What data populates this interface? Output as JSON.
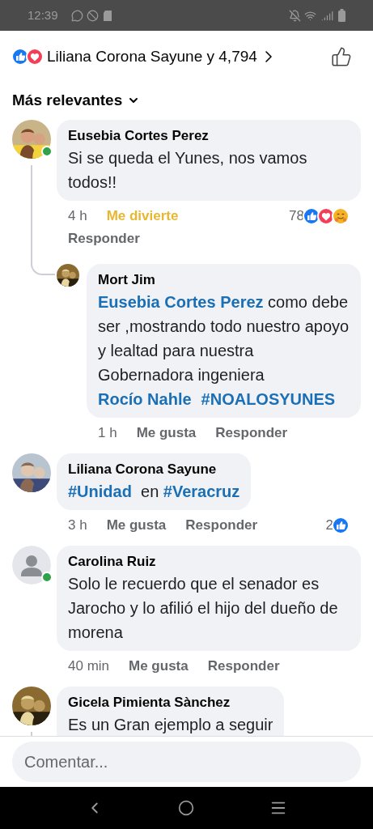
{
  "status_bar": {
    "time": "12:39"
  },
  "reactions_summary": {
    "reactions": [
      {
        "kind": "like"
      },
      {
        "kind": "love"
      }
    ],
    "text": "Liliana Corona Sayune y 4,794"
  },
  "sort": {
    "label": "Más relevantes"
  },
  "comments": [
    {
      "author": "Eusebia Cortes Perez",
      "avatar": {
        "kind": "picture"
      },
      "online": true,
      "thread_line": true,
      "segments": [
        {
          "kind": "plain",
          "text": "Si se queda el Yunes, nos vamos todos!!"
        }
      ],
      "time": "4 h",
      "actions": [
        {
          "label": "Me divierte",
          "reacted": true
        },
        {
          "label": "Responder",
          "reacted": false
        }
      ],
      "reaction_count": "78",
      "reactions": [
        {
          "kind": "like"
        },
        {
          "kind": "love"
        },
        {
          "kind": "haha"
        }
      ],
      "replies": [
        {
          "author": "Mort Jim",
          "avatar": {
            "kind": "picture"
          },
          "online": false,
          "thread_line": false,
          "segments": [
            {
              "kind": "mention",
              "text": "Eusebia Cortes Perez"
            },
            {
              "kind": "plain",
              "text": " como debe ser ,mostrando todo nuestro apoyo y lealtad para nuestra Gobernadora ingeniera "
            },
            {
              "kind": "mention",
              "text": "Rocío Nahle"
            },
            {
              "kind": "mention",
              "text": "#NOALOSYUNES"
            }
          ],
          "time": "1 h",
          "actions": [
            {
              "label": "Me gusta",
              "reacted": false
            },
            {
              "label": "Responder",
              "reacted": false
            }
          ]
        }
      ]
    },
    {
      "author": "Liliana Corona Sayune",
      "avatar": {
        "kind": "picture"
      },
      "online": false,
      "thread_line": false,
      "segments": [
        {
          "kind": "mention",
          "text": "#Unidad"
        },
        {
          "kind": "plain",
          "text": "  en "
        },
        {
          "kind": "mention",
          "text": "#Veracruz"
        }
      ],
      "time": "3 h",
      "actions": [
        {
          "label": "Me gusta",
          "reacted": false
        },
        {
          "label": "Responder",
          "reacted": false
        }
      ],
      "reaction_count": "2",
      "reactions": [
        {
          "kind": "like"
        }
      ]
    },
    {
      "author": "Carolina Ruiz",
      "avatar": {
        "kind": "default"
      },
      "online": true,
      "thread_line": false,
      "segments": [
        {
          "kind": "plain",
          "text": "Solo le recuerdo que el senador es Jarocho y lo afilió el hijo del dueño de morena"
        }
      ],
      "time": "40 min",
      "actions": [
        {
          "label": "Me gusta",
          "reacted": false
        },
        {
          "label": "Responder",
          "reacted": false
        }
      ]
    },
    {
      "author": "Gicela Pimienta Sànchez",
      "avatar": {
        "kind": "picture"
      },
      "online": false,
      "thread_line": true,
      "segments": [
        {
          "kind": "plain",
          "text": "Es un Gran ejemplo a seguir"
        }
      ]
    }
  ],
  "composer": {
    "placeholder": "Comentar..."
  }
}
